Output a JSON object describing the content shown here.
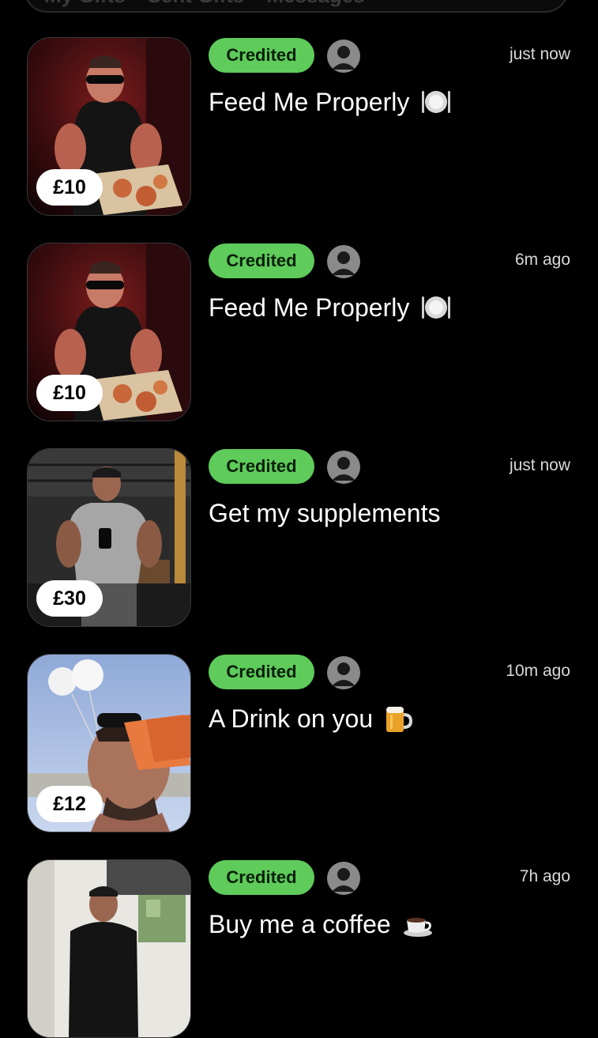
{
  "tabs": [
    "My Gifts",
    "Sent Gifts",
    "Messages"
  ],
  "gifts": [
    {
      "price": "£10",
      "status": "Credited",
      "title": "Feed Me Properly",
      "emoji_icon": "plate-cutlery-icon",
      "time": "just now",
      "photo": "man-eating-pizza-red-room"
    },
    {
      "price": "£10",
      "status": "Credited",
      "title": "Feed Me Properly",
      "emoji_icon": "plate-cutlery-icon",
      "time": "6m ago",
      "photo": "man-eating-pizza-red-room"
    },
    {
      "price": "£30",
      "status": "Credited",
      "title": "Get my supplements",
      "emoji_icon": "",
      "time": "just now",
      "photo": "man-gym-mirror-selfie"
    },
    {
      "price": "£12",
      "status": "Credited",
      "title": "A Drink on you",
      "emoji_icon": "beer-mug-icon",
      "time": "10m ago",
      "photo": "man-drinking-balloons-sky"
    },
    {
      "price": "",
      "status": "Credited",
      "title": "Buy me a coffee",
      "emoji_icon": "coffee-cup-icon",
      "time": "7h ago",
      "photo": "man-selfie-kitchen"
    }
  ],
  "colors": {
    "background": "#000000",
    "status_green": "#5ecb5b",
    "price_badge_bg": "#ffffff",
    "avatar_grey": "#8a8a8a"
  }
}
